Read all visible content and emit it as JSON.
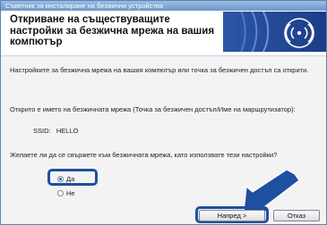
{
  "window": {
    "title": "Съветник за инсталиране на безжични устройства"
  },
  "header": {
    "title": "Откриване на съществуващите настройки за безжична мрежа на вашия компютър"
  },
  "body": {
    "intro": "Настройките за безжична мрежа на вашия компютър или точка за безжичен достъп са открити.",
    "detected_label": "Открито е името на безжичната мрежа (Точка за безжичен достъп/Име на маршрутизатор):",
    "ssid_label": "SSID:",
    "ssid_value": "HELLO",
    "question": "Желаете ли да се свържете към безжичната мрежа, като използвате тези настройки?"
  },
  "options": [
    {
      "label": "Да",
      "selected": true
    },
    {
      "label": "Не",
      "selected": false
    }
  ],
  "buttons": {
    "next": "Напред >",
    "cancel": "Отказ"
  },
  "colors": {
    "accent": "#1f4fa0",
    "banner": "#2c56a8"
  },
  "icons": {
    "banner": "wifi-icon",
    "pointer": "arrow-icon"
  }
}
